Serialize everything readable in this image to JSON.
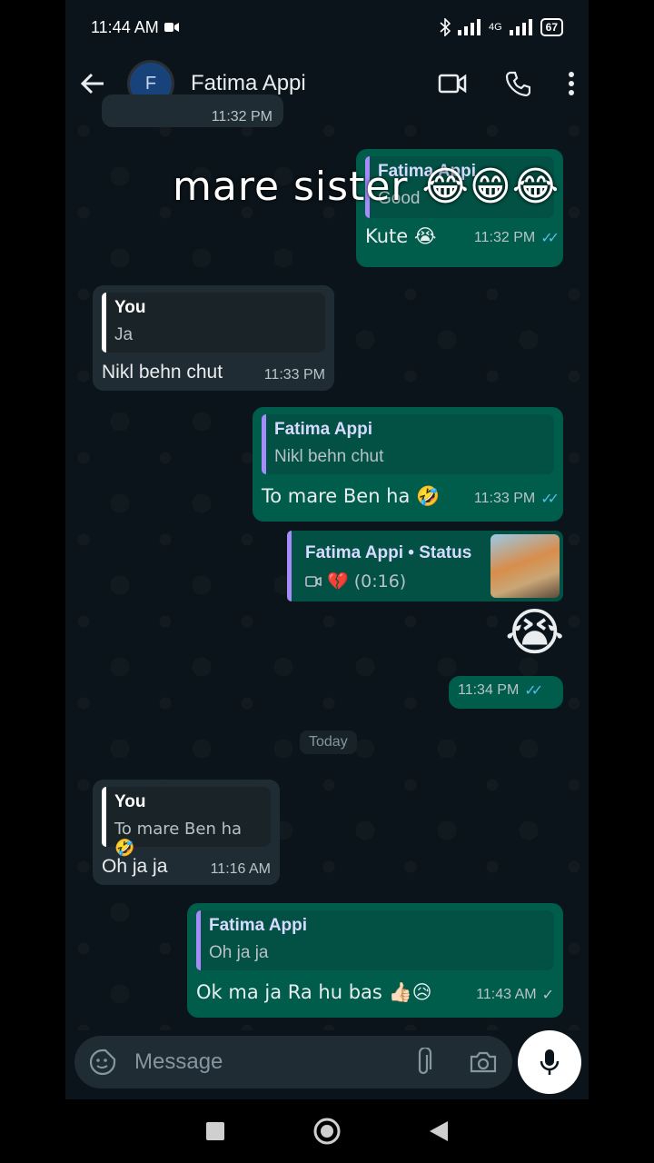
{
  "status_bar": {
    "time": "11:44 AM",
    "network": "4G",
    "battery": "67"
  },
  "header": {
    "avatar_letter": "F",
    "contact_name": "Fatima Appi"
  },
  "overlay": {
    "text": "mare sister 😂😁😂"
  },
  "partial_time": "11:32 PM",
  "messages": [
    {
      "quote_name": "Fatima Appi",
      "quote_text": "Good",
      "text": "Kute 😭",
      "time": "11:32 PM"
    },
    {
      "quote_name": "You",
      "quote_text": "Ja",
      "text": "Nikl behn chut",
      "time": "11:33 PM"
    },
    {
      "quote_name": "Fatima Appi",
      "quote_text": "Nikl behn chut",
      "text": "To mare Ben ha 🤣",
      "time": "11:33 PM"
    },
    {
      "quote_name": "Fatima Appi • Status",
      "quote_text": "💔 (0:16)",
      "text": "😭",
      "time": "11:34 PM"
    },
    {
      "quote_name": "You",
      "quote_text": "To mare Ben ha 🤣",
      "text": "Oh ja ja",
      "time": "11:16 AM"
    },
    {
      "quote_name": "Fatima Appi",
      "quote_text": "Oh ja ja",
      "text": "Ok ma ja Ra hu bas 👍🏻😥",
      "time": "11:43 AM"
    }
  ],
  "date_divider": "Today",
  "composer": {
    "placeholder": "Message"
  },
  "colors": {
    "outgoing": "#005c4b",
    "incoming": "#202c33",
    "read_ticks": "#53bdeb"
  }
}
